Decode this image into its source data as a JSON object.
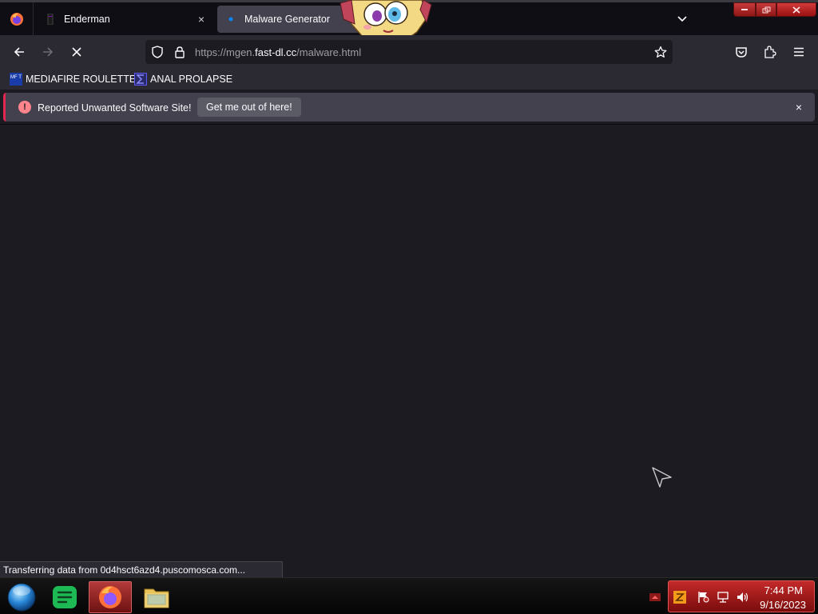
{
  "tabs": [
    {
      "title": "Enderman",
      "close": "×"
    },
    {
      "title": "Malware Generator"
    }
  ],
  "navbar": {
    "url_prefix": "https://mgen.",
    "url_host": "fast-dl.cc",
    "url_path": "/malware.html"
  },
  "bookmarks": [
    {
      "label": "MEDIAFIRE ROULETTER",
      "icon": "MF T"
    },
    {
      "label": "ANAL PROLAPSE"
    }
  ],
  "notification": {
    "message": "Reported Unwanted Software Site!",
    "button": "Get me out of here!",
    "close": "×"
  },
  "status_text": "Transferring data from 0d4hsct6azd4.puscomosca.com...",
  "clock": {
    "time": "7:44 PM",
    "date": "9/16/2023"
  },
  "colors": {
    "warning_accent": "#e22850",
    "tray_red": "#c42a2a"
  }
}
